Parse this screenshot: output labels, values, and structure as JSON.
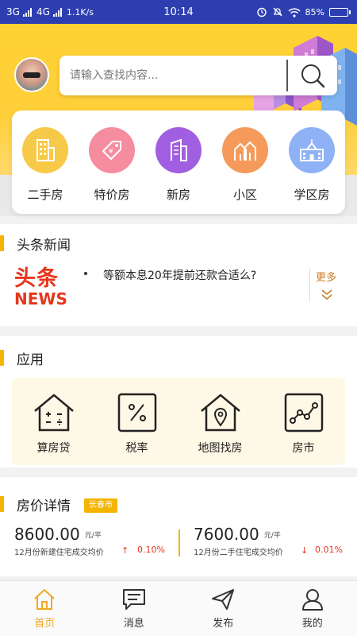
{
  "status_bar": {
    "network1": "3G",
    "network2": "4G",
    "speed": "1.1K/s",
    "time": "10:14",
    "battery": "85%",
    "battery_level": 0.85
  },
  "search": {
    "placeholder": "请输入查找内容..."
  },
  "categories": [
    {
      "label": "二手房",
      "icon": "building-icon",
      "color": "#f7c948"
    },
    {
      "label": "特价房",
      "icon": "price-tag-icon",
      "color": "#f58ca0"
    },
    {
      "label": "新房",
      "icon": "new-building-icon",
      "color": "#a05ee0"
    },
    {
      "label": "小区",
      "icon": "houses-icon",
      "color": "#f59a5a"
    },
    {
      "label": "学区房",
      "icon": "school-icon",
      "color": "#8fb1f5"
    }
  ],
  "news": {
    "title": "头条新闻",
    "logo_cn": "头条",
    "logo_en": "NEWS",
    "headline": "等额本息20年提前还款合适么?",
    "more": "更多"
  },
  "apps": {
    "title": "应用",
    "items": [
      {
        "label": "算房贷",
        "icon": "calculator-house-icon"
      },
      {
        "label": "税率",
        "icon": "percent-icon"
      },
      {
        "label": "地图找房",
        "icon": "map-pin-house-icon"
      },
      {
        "label": "房市",
        "icon": "trend-chart-icon"
      }
    ]
  },
  "price": {
    "title": "房价详情",
    "city": "长春市",
    "new": {
      "value": "8600.00",
      "unit": "元/平",
      "desc": "12月份新建住宅成交均价",
      "change": "0.10%",
      "direction": "up"
    },
    "second": {
      "value": "7600.00",
      "unit": "元/平",
      "desc": "12月份二手住宅成交均价",
      "change": "0.01%",
      "direction": "down"
    },
    "up_color": "#e5361c",
    "down_color": "#e5361c"
  },
  "tabs": [
    {
      "label": "首页",
      "icon": "home-icon",
      "active": true
    },
    {
      "label": "消息",
      "icon": "message-icon",
      "active": false
    },
    {
      "label": "发布",
      "icon": "send-icon",
      "active": false
    },
    {
      "label": "我的",
      "icon": "user-icon",
      "active": false
    }
  ],
  "colors": {
    "accent": "#f5a623",
    "status_bar": "#2d3fb0",
    "hero": "#ffd233"
  }
}
